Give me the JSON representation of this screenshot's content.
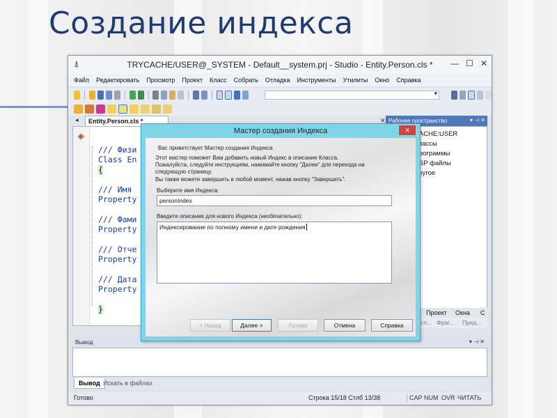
{
  "slide": {
    "title": "Создание индекса"
  },
  "window": {
    "title": "TRYCACHE/USER@_SYSTEM - Default__system.prj - Studio - Entity.Person.cls *",
    "controls": {
      "minimize": "—",
      "maximize": "☐",
      "close": "✕"
    }
  },
  "menu": [
    "Файл",
    "Редактировать",
    "Просмотр",
    "Проект",
    "Класс",
    "Собрать",
    "Отладка",
    "Инструменты",
    "Утилиты",
    "Окно",
    "Справка"
  ],
  "editor": {
    "tab_label": "Entity.Person.cls *",
    "tab_close": "✕",
    "tab_arrow": "◂",
    "code_lines": [
      "/// Физи",
      "Class En",
      "{",
      "",
      "/// Имя",
      "Property",
      "",
      "/// Фами",
      "Property",
      "",
      "/// Отче",
      "Property",
      "",
      "/// Дата",
      "Property",
      "",
      "}"
    ]
  },
  "workspace": {
    "header": "Рабочее пространство",
    "header_btns": "▾ ⊣ ✕",
    "items": [
      "CACHE:USER",
      "Классы",
      "Программы",
      "CSP файлы",
      "Другое"
    ],
    "tabs": [
      "Проект",
      "Окна",
      "С"
    ],
    "tabs2": [
      "Исп...",
      "Фраг...",
      "Пред..."
    ]
  },
  "output": {
    "header": "Вывод",
    "header_btns": "▾ ⊣ ✕",
    "tabs": [
      "Вывод",
      "Искать в файлах"
    ]
  },
  "status": {
    "ready": "Готово",
    "position": "Строка 15/18 Стлб 13/38",
    "flags": [
      "CAP",
      "NUM",
      "OVR",
      "ЧИТАТЬ"
    ]
  },
  "dialog": {
    "title": "Мастер создания Индекса",
    "close": "✕",
    "welcome": "Вас приветствует Мастер создания Индекса",
    "intro_lines": [
      "Этот мастер поможет Вам добавить новый Индекс в описание Класса.",
      "Пожалуйста, следуйте инструкциям, нажимайте кнопку \"Далее\" для перехода на",
      "следующую страницу.",
      "Вы также можете завершить в любой момент, нажав кнопку \"Завершить\"."
    ],
    "name_label": "Выберите имя Индекса:",
    "name_value": "personIndex",
    "desc_label": "Введите описание для нового Индекса (необязательно):",
    "desc_value": "Индексирование по полному имени и дате рождения",
    "buttons": {
      "back": "< Назад",
      "next": "Далее >",
      "finish": "Готово",
      "cancel": "Отмена",
      "help": "Справка"
    }
  }
}
